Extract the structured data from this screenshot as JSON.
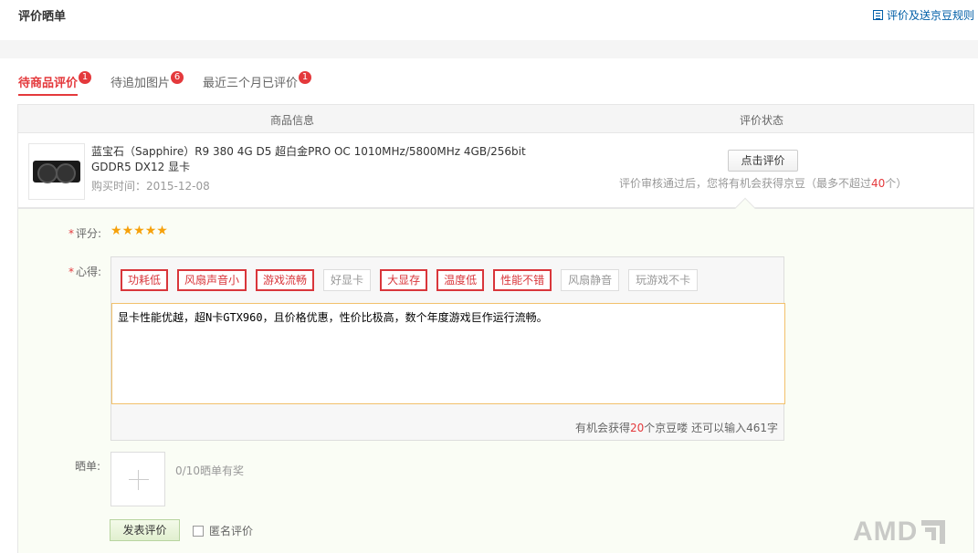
{
  "header": {
    "title": "评价晒单",
    "rules_link": "评价及送京豆规则",
    "rules_icon": "document-list-icon"
  },
  "tabs": [
    {
      "label": "待商品评价",
      "badge": "1",
      "active": true
    },
    {
      "label": "待追加图片",
      "badge": "6",
      "active": false
    },
    {
      "label": "最近三个月已评价",
      "badge": "1",
      "active": false
    }
  ],
  "order": {
    "col_product": "商品信息",
    "col_status": "评价状态",
    "product_name": "蓝宝石（Sapphire）R9 380 4G D5 超白金PRO OC 1010MHz/5800MHz 4GB/256bit GDDR5 DX12 显卡",
    "purchase_time": "购买时间：2015-12-08",
    "review_button": "点击评价",
    "bean_note_prefix": "评价审核通过后，您将有机会获得京豆（最多不超过",
    "bean_note_number": "40",
    "bean_note_suffix": "个）"
  },
  "form": {
    "rating_label": "评分:",
    "rating_value": 5,
    "rating_max": 5,
    "experience_label": "心得:",
    "tags": [
      {
        "label": "功耗低",
        "selected": true
      },
      {
        "label": "风扇声音小",
        "selected": true
      },
      {
        "label": "游戏流畅",
        "selected": true
      },
      {
        "label": "好显卡",
        "selected": false
      },
      {
        "label": "大显存",
        "selected": true
      },
      {
        "label": "温度低",
        "selected": true
      },
      {
        "label": "性能不错",
        "selected": true
      },
      {
        "label": "风扇静音",
        "selected": false
      },
      {
        "label": "玩游戏不卡",
        "selected": false
      }
    ],
    "review_text": "显卡性能优越，超N卡GTX960，且价格优惠，性价比极高，数个年度游戏巨作运行流畅。",
    "count_prefix": "有机会获得",
    "count_beans": "20",
    "count_middle": "个京豆喽 还可以输入",
    "count_remaining": "461",
    "count_suffix": "字",
    "photo_label": "晒单:",
    "photo_note": "0/10晒单有奖",
    "submit_button": "发表评价",
    "anonymous_label": "匿名评价"
  },
  "watermark": {
    "text": "AMD"
  }
}
